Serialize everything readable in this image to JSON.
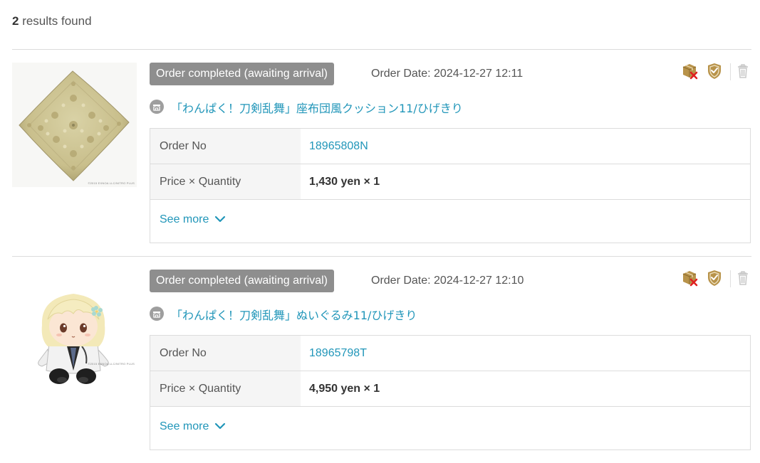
{
  "results": {
    "count": "2",
    "suffix": " results found"
  },
  "orders": [
    {
      "status": "Order completed (awaiting arrival)",
      "order_date": "Order Date: 2024-12-27 12:11",
      "product_name": "「わんぱく！刀剣乱舞」座布団風クッション11/ひげきり",
      "order_no_label": "Order No",
      "order_no": "18965808N",
      "price_qty_label": "Price × Quantity",
      "price_qty": "1,430 yen × 1",
      "see_more": "See more",
      "image_copyright": "©2015 EXNOA LLC/NITRO PLUS"
    },
    {
      "status": "Order completed (awaiting arrival)",
      "order_date": "Order Date: 2024-12-27 12:10",
      "product_name": "「わんぱく！刀剣乱舞」ぬいぐるみ11/ひげきり",
      "order_no_label": "Order No",
      "order_no": "18965798T",
      "price_qty_label": "Price × Quantity",
      "price_qty": "4,950 yen × 1",
      "see_more": "See more",
      "image_copyright": "©2015 EXNOA LLC/NITRO PLUS"
    }
  ],
  "icons": {
    "package_cancel": "package-cancel-icon",
    "shield": "shield-check-icon",
    "trash": "trash-icon",
    "shop": "shop-icon",
    "chevron": "chevron-down-icon"
  },
  "colors": {
    "link": "#2196b9",
    "badge_bg": "#8e8e8e",
    "label_bg": "#f5f5f5",
    "gold": "#b8934a"
  }
}
